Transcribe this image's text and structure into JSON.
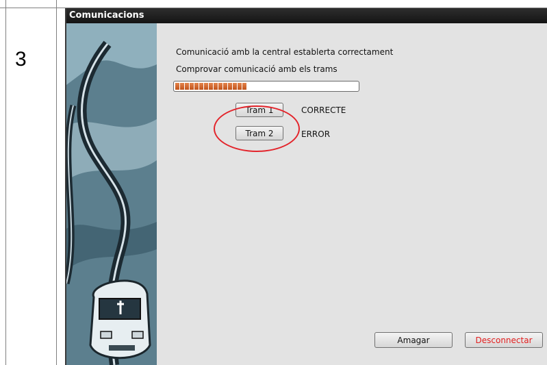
{
  "step": {
    "number": "3"
  },
  "window": {
    "title": "Comunicacions"
  },
  "messages": {
    "line1": "Comunicació amb la central establerta correctament",
    "line2": "Comprovar comunicació amb els  trams"
  },
  "progress": {
    "fraction": 0.52,
    "segments": 15,
    "color": "#d0662f"
  },
  "trams": [
    {
      "label": "Tram 1",
      "status": "CORRECTE"
    },
    {
      "label": "Tram 2",
      "status": "ERROR"
    }
  ],
  "actions": {
    "hide_label": "Amagar",
    "disconnect_label": "Desconnectar",
    "disconnect_color": "#e21d1d"
  },
  "annotation": {
    "color": "#e3242b"
  }
}
